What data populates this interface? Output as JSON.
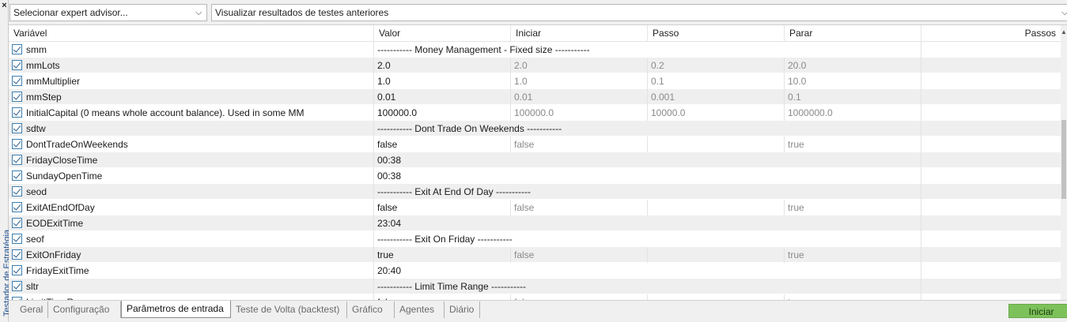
{
  "side": {
    "close": "×",
    "title": "Testador de Estratégia"
  },
  "topbar": {
    "expert_select": "Selecionar expert advisor...",
    "results_select": "Visualizar resultados de testes anteriores",
    "arrow": "⌵"
  },
  "grid": {
    "headers": {
      "variable": "Variável",
      "value": "Valor",
      "start": "Iniciar",
      "step": "Passo",
      "stop": "Parar",
      "steps": "Passos"
    },
    "rows": [
      {
        "name": "smm",
        "separator": "----------- Money Management - Fixed size -----------"
      },
      {
        "name": "mmLots",
        "value": "2.0",
        "start": "2.0",
        "step": "0.2",
        "stop": "20.0"
      },
      {
        "name": "mmMultiplier",
        "value": "1.0",
        "start": "1.0",
        "step": "0.1",
        "stop": "10.0"
      },
      {
        "name": "mmStep",
        "value": "0.01",
        "start": "0.01",
        "step": "0.001",
        "stop": "0.1"
      },
      {
        "name": "InitialCapital (0 means whole account balance). Used in some MM",
        "value": "100000.0",
        "start": "100000.0",
        "step": "10000.0",
        "stop": "1000000.0"
      },
      {
        "name": "sdtw",
        "separator": "----------- Dont Trade On Weekends -----------"
      },
      {
        "name": "DontTradeOnWeekends",
        "value": "false",
        "start": "false",
        "step": "",
        "stop": "true"
      },
      {
        "name": "FridayCloseTime",
        "value": "00:38",
        "single": true
      },
      {
        "name": "SundayOpenTime",
        "value": "00:38",
        "single": true
      },
      {
        "name": "seod",
        "separator": "----------- Exit At End Of Day -----------"
      },
      {
        "name": "ExitAtEndOfDay",
        "value": "false",
        "start": "false",
        "step": "",
        "stop": "true"
      },
      {
        "name": "EODExitTime",
        "value": "23:04",
        "single": true
      },
      {
        "name": "seof",
        "separator": "----------- Exit On Friday -----------"
      },
      {
        "name": "ExitOnFriday",
        "value": "true",
        "start": "false",
        "step": "",
        "stop": "true"
      },
      {
        "name": "FridayExitTime",
        "value": "20:40",
        "single": true
      },
      {
        "name": "sltr",
        "separator": "----------- Limit Time Range -----------"
      },
      {
        "name": "LimitTimeRange",
        "value": "false",
        "start": "false",
        "step": "",
        "stop": "true"
      }
    ]
  },
  "tabs": [
    {
      "label": "Geral",
      "active": false
    },
    {
      "label": "Configuração",
      "active": false
    },
    {
      "label": "Parâmetros de entrada",
      "active": true
    },
    {
      "label": "Teste de Volta (backtest)",
      "active": false
    },
    {
      "label": "Gráfico",
      "active": false
    },
    {
      "label": "Agentes",
      "active": false
    },
    {
      "label": "Diário",
      "active": false
    }
  ],
  "start_button": "Iniciar",
  "colors": {
    "start_button": "#7dc15b",
    "checkbox_border": "#3c7fb1",
    "alt_row": "#efefef"
  }
}
